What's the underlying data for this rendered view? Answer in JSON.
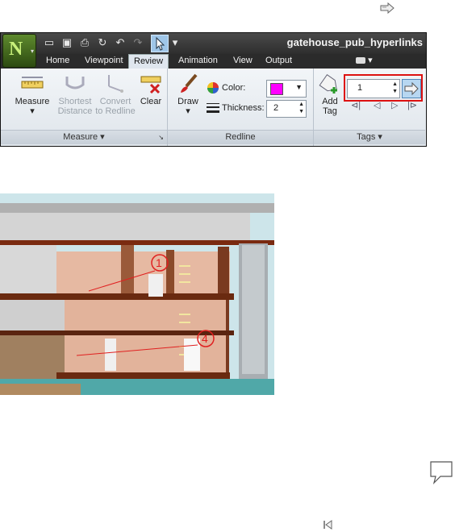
{
  "window": {
    "title": "gatehouse_pub_hyperlinks"
  },
  "tabs": [
    "Home",
    "Viewpoint",
    "Review",
    "Animation",
    "View",
    "Output"
  ],
  "active_tab": "Review",
  "measure_group": {
    "label": "Measure",
    "buttons": [
      {
        "line1": "Measure",
        "line2": ""
      },
      {
        "line1": "Shortest",
        "line2": "Distance"
      },
      {
        "line1": "Convert",
        "line2": "to Redline"
      },
      {
        "line1": "Clear",
        "line2": ""
      }
    ]
  },
  "redline_group": {
    "label": "Redline",
    "draw_label": "Draw",
    "color_label": "Color:",
    "color_value": "#ff00ff",
    "thickness_label": "Thickness:",
    "thickness_value": "2"
  },
  "tags_group": {
    "label": "Tags",
    "add_tag_line1": "Add",
    "add_tag_line2": "Tag",
    "tag_id_value": "1"
  },
  "viewport": {
    "tags": [
      "1",
      "4"
    ]
  },
  "colors": {
    "ribbon_dark": "#2b2b2b",
    "highlight": "#dd1111",
    "tag_red": "#e02020"
  }
}
